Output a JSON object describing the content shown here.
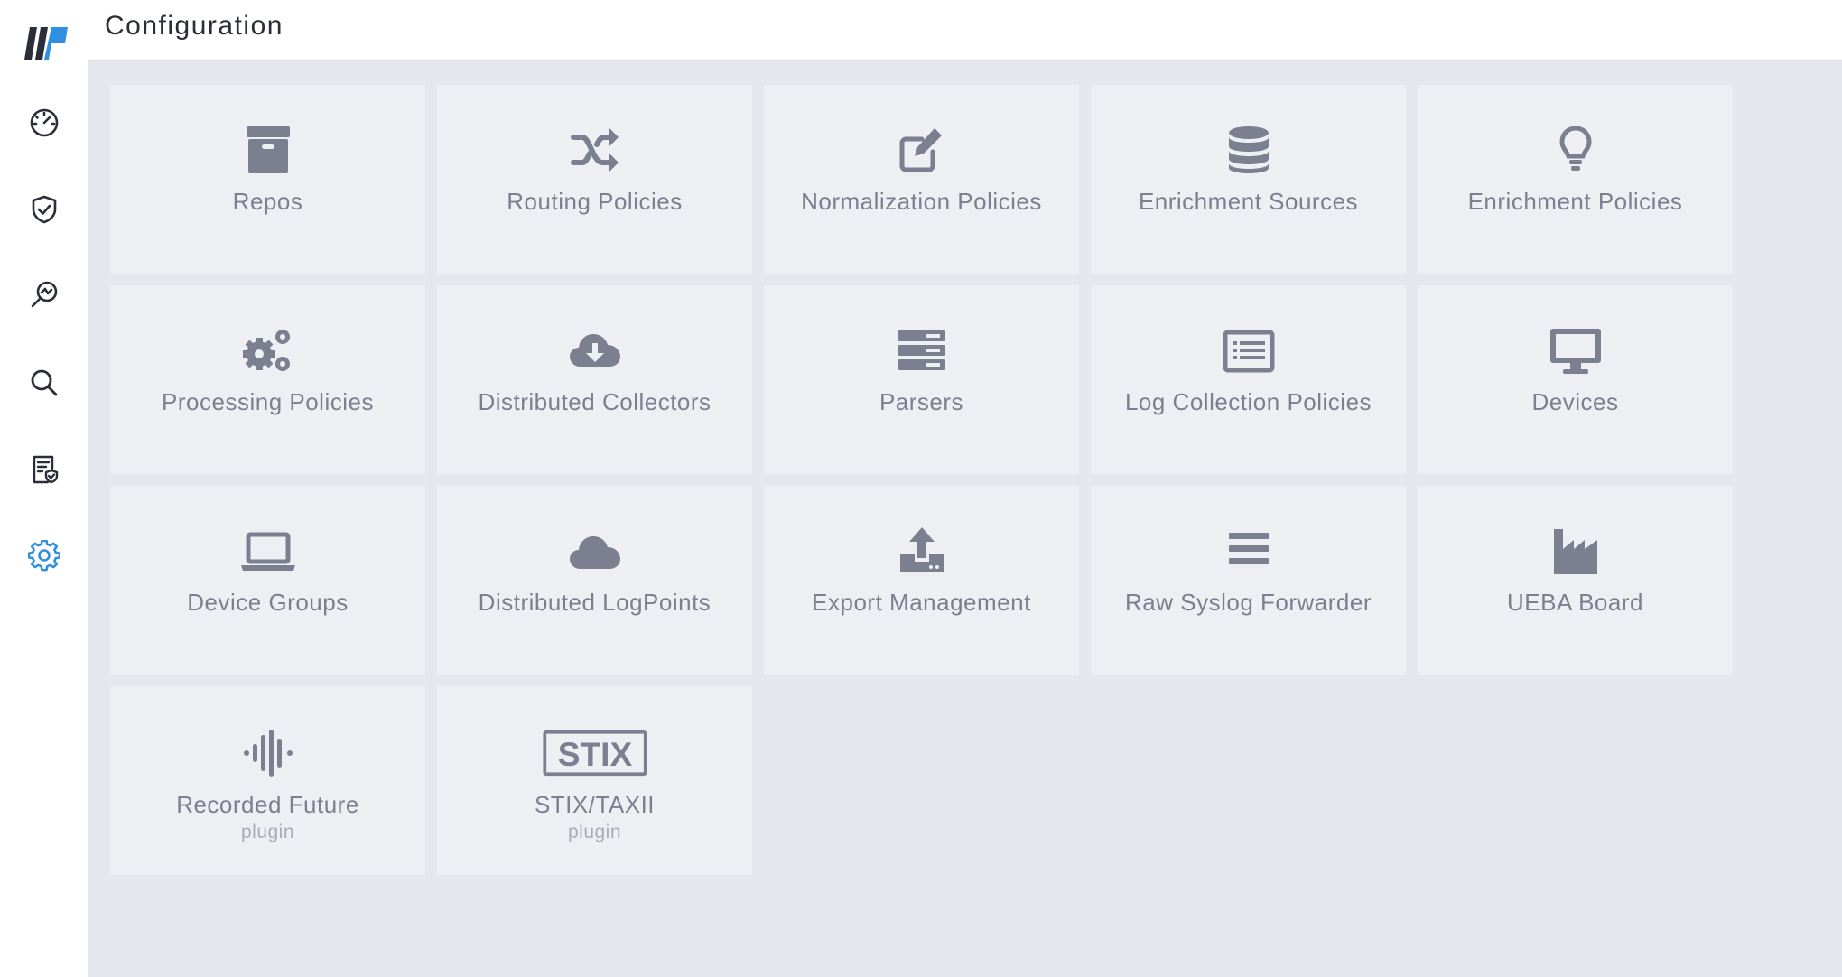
{
  "header": {
    "title": "Configuration"
  },
  "sidebar": {
    "items": [
      {
        "name": "dashboard",
        "icon": "gauge-icon"
      },
      {
        "name": "incidents",
        "icon": "shield-check-icon"
      },
      {
        "name": "search-analytics",
        "icon": "magnify-chart-icon"
      },
      {
        "name": "search",
        "icon": "search-icon"
      },
      {
        "name": "reports",
        "icon": "report-shield-icon"
      },
      {
        "name": "settings",
        "icon": "gear-icon",
        "active": true
      }
    ]
  },
  "colors": {
    "accent": "#2f8fe0",
    "sidebar_icon": "#2b2e38",
    "card_icon": "#7b7f90",
    "card_bg": "#eeeff3",
    "page_bg": "#e6e7ec"
  },
  "cards": [
    {
      "label": "Repos",
      "icon": "archive-box-icon"
    },
    {
      "label": "Routing Policies",
      "icon": "shuffle-icon"
    },
    {
      "label": "Normalization Policies",
      "icon": "edit-icon"
    },
    {
      "label": "Enrichment Sources",
      "icon": "database-icon"
    },
    {
      "label": "Enrichment Policies",
      "icon": "lightbulb-icon"
    },
    {
      "label": "Processing Policies",
      "icon": "gears-icon"
    },
    {
      "label": "Distributed Collectors",
      "icon": "cloud-download-icon"
    },
    {
      "label": "Parsers",
      "icon": "server-icon"
    },
    {
      "label": "Log Collection Policies",
      "icon": "list-window-icon"
    },
    {
      "label": "Devices",
      "icon": "monitor-icon"
    },
    {
      "label": "Device Groups",
      "icon": "laptop-icon"
    },
    {
      "label": "Distributed LogPoints",
      "icon": "cloud-icon"
    },
    {
      "label": "Export Management",
      "icon": "upload-icon"
    },
    {
      "label": "Raw Syslog Forwarder",
      "icon": "bars-icon"
    },
    {
      "label": "UEBA Board",
      "icon": "factory-icon"
    },
    {
      "label": "Recorded Future",
      "sublabel": "plugin",
      "icon": "waveform-icon"
    },
    {
      "label": "STIX/TAXII",
      "sublabel": "plugin",
      "icon": "stix-logo",
      "logo_text": "STIX"
    }
  ]
}
